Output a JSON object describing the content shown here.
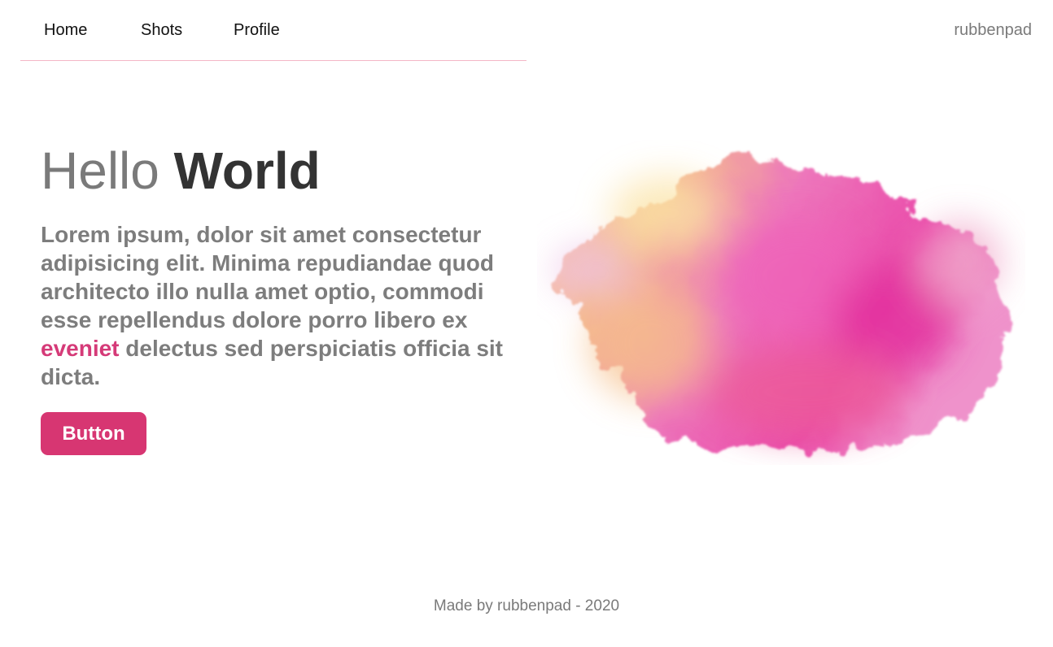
{
  "nav": {
    "items": [
      {
        "label": "Home"
      },
      {
        "label": "Shots"
      },
      {
        "label": "Profile"
      }
    ],
    "brand": "rubbenpad"
  },
  "hero": {
    "title_light": "Hello",
    "title_bold": "World",
    "body_before": "Lorem ipsum, dolor sit amet consectetur adipisicing elit. Minima repudiandae quod architecto illo nulla amet optio, commodi esse repellendus dolore porro libero ex",
    "body_accent": "eveniet",
    "body_after": "delectus sed perspiciatis officia sit dicta.",
    "button_label": "Button"
  },
  "footer": {
    "text": "Made by rubbenpad - 2020"
  },
  "colors": {
    "accent": "#d73672",
    "muted_text": "#7a7a7a",
    "dark_text": "#333333",
    "nav_rule": "#f4b6c6"
  },
  "art": {
    "icon": "watercolor-splash-image"
  }
}
